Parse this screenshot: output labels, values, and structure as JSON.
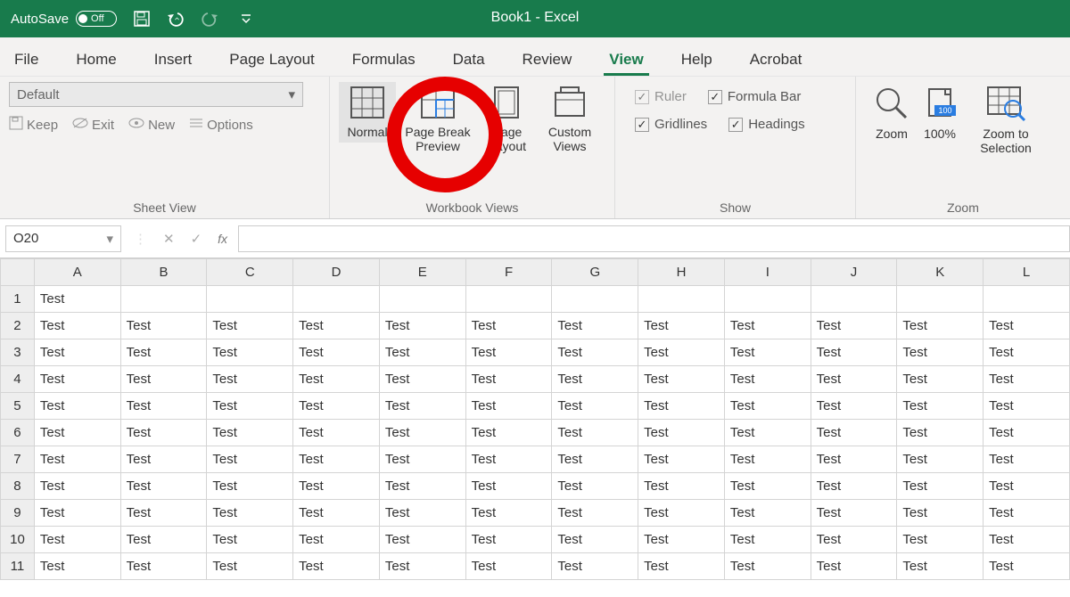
{
  "titlebar": {
    "autosave_label": "AutoSave",
    "autosave_state": "Off",
    "doc_title": "Book1  -  Excel"
  },
  "tabs": [
    "File",
    "Home",
    "Insert",
    "Page Layout",
    "Formulas",
    "Data",
    "Review",
    "View",
    "Help",
    "Acrobat"
  ],
  "active_tab": "View",
  "ribbon": {
    "sheet_view": {
      "select_label": "Default",
      "keep": "Keep",
      "exit": "Exit",
      "new": "New",
      "options": "Options",
      "group_label": "Sheet View"
    },
    "workbook_views": {
      "normal": "Normal",
      "page_break": "Page Break Preview",
      "page_layout": "Page Layout",
      "custom_views": "Custom Views",
      "group_label": "Workbook Views"
    },
    "show": {
      "ruler": "Ruler",
      "formula_bar": "Formula Bar",
      "gridlines": "Gridlines",
      "headings": "Headings",
      "group_label": "Show"
    },
    "zoom": {
      "zoom": "Zoom",
      "hundred": "100%",
      "to_selection": "Zoom to Selection",
      "group_label": "Zoom"
    }
  },
  "formula_bar": {
    "name_box": "O20",
    "fx": "fx",
    "input": ""
  },
  "grid": {
    "columns": [
      "A",
      "B",
      "C",
      "D",
      "E",
      "F",
      "G",
      "H",
      "I",
      "J",
      "K",
      "L"
    ],
    "rows": [
      {
        "num": "1",
        "cells": [
          "Test",
          "",
          "",
          "",
          "",
          "",
          "",
          "",
          "",
          "",
          "",
          ""
        ]
      },
      {
        "num": "2",
        "cells": [
          "Test",
          "Test",
          "Test",
          "Test",
          "Test",
          "Test",
          "Test",
          "Test",
          "Test",
          "Test",
          "Test",
          "Test"
        ]
      },
      {
        "num": "3",
        "cells": [
          "Test",
          "Test",
          "Test",
          "Test",
          "Test",
          "Test",
          "Test",
          "Test",
          "Test",
          "Test",
          "Test",
          "Test"
        ]
      },
      {
        "num": "4",
        "cells": [
          "Test",
          "Test",
          "Test",
          "Test",
          "Test",
          "Test",
          "Test",
          "Test",
          "Test",
          "Test",
          "Test",
          "Test"
        ]
      },
      {
        "num": "5",
        "cells": [
          "Test",
          "Test",
          "Test",
          "Test",
          "Test",
          "Test",
          "Test",
          "Test",
          "Test",
          "Test",
          "Test",
          "Test"
        ]
      },
      {
        "num": "6",
        "cells": [
          "Test",
          "Test",
          "Test",
          "Test",
          "Test",
          "Test",
          "Test",
          "Test",
          "Test",
          "Test",
          "Test",
          "Test"
        ]
      },
      {
        "num": "7",
        "cells": [
          "Test",
          "Test",
          "Test",
          "Test",
          "Test",
          "Test",
          "Test",
          "Test",
          "Test",
          "Test",
          "Test",
          "Test"
        ]
      },
      {
        "num": "8",
        "cells": [
          "Test",
          "Test",
          "Test",
          "Test",
          "Test",
          "Test",
          "Test",
          "Test",
          "Test",
          "Test",
          "Test",
          "Test"
        ]
      },
      {
        "num": "9",
        "cells": [
          "Test",
          "Test",
          "Test",
          "Test",
          "Test",
          "Test",
          "Test",
          "Test",
          "Test",
          "Test",
          "Test",
          "Test"
        ]
      },
      {
        "num": "10",
        "cells": [
          "Test",
          "Test",
          "Test",
          "Test",
          "Test",
          "Test",
          "Test",
          "Test",
          "Test",
          "Test",
          "Test",
          "Test"
        ]
      },
      {
        "num": "11",
        "cells": [
          "Test",
          "Test",
          "Test",
          "Test",
          "Test",
          "Test",
          "Test",
          "Test",
          "Test",
          "Test",
          "Test",
          "Test"
        ]
      }
    ]
  }
}
